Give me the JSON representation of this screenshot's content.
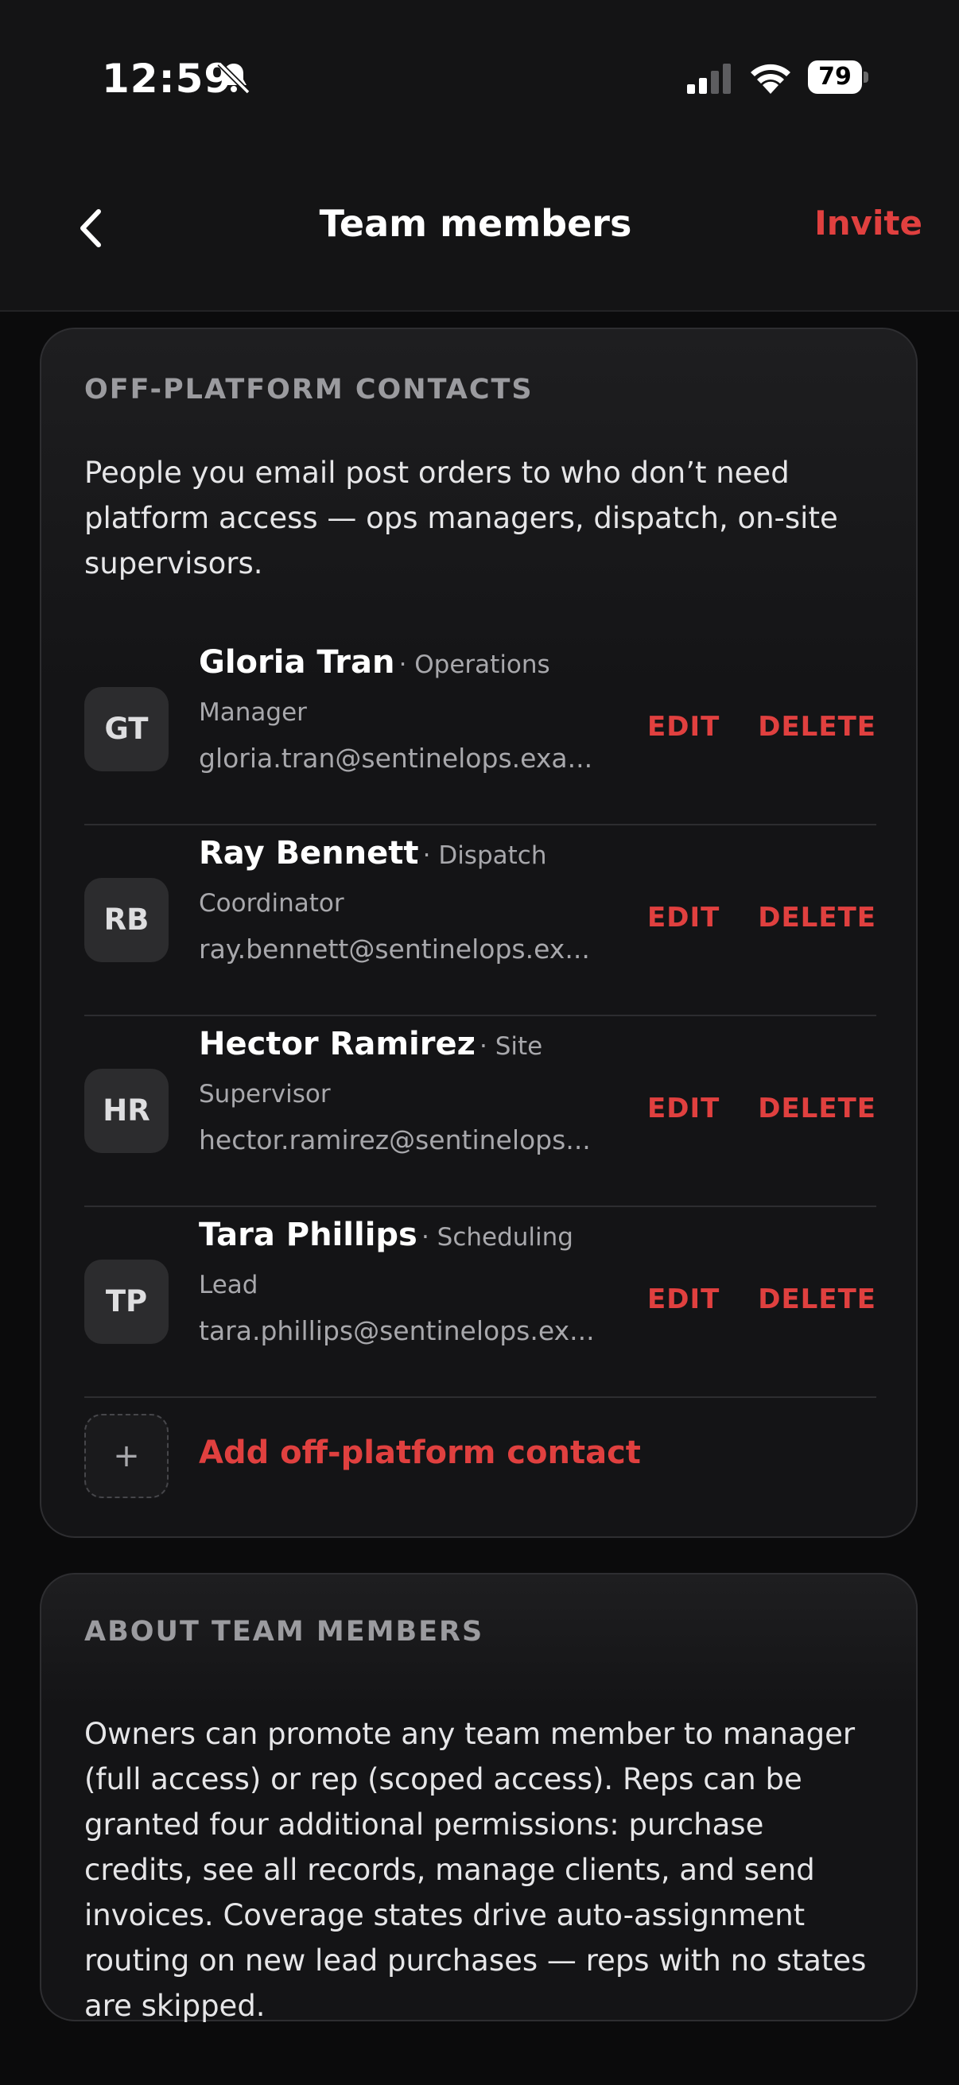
{
  "status_bar": {
    "time": "12:59",
    "battery": "79"
  },
  "nav": {
    "title": "Team members",
    "invite_label": "Invite"
  },
  "off_platform": {
    "section_title": "OFF-PLATFORM CONTACTS",
    "description": "People you email post orders to who don’t need platform access — ops managers, dispatch, on-site supervisors.",
    "edit_label": "EDIT",
    "delete_label": "DELETE",
    "contacts": [
      {
        "initials": "GT",
        "name": "Gloria Tran",
        "role_part1": "· Operations",
        "role_part2": "Manager",
        "email": "gloria.tran@sentinelops.exa..."
      },
      {
        "initials": "RB",
        "name": "Ray Bennett",
        "role_part1": "· Dispatch",
        "role_part2": "Coordinator",
        "email": "ray.bennett@sentinelops.ex..."
      },
      {
        "initials": "HR",
        "name": "Hector Ramirez",
        "role_part1": "· Site",
        "role_part2": "Supervisor",
        "email": "hector.ramirez@sentinelops..."
      },
      {
        "initials": "TP",
        "name": "Tara Phillips",
        "role_part1": "· Scheduling",
        "role_part2": "Lead",
        "email": "tara.phillips@sentinelops.ex..."
      }
    ],
    "add_icon": "+",
    "add_label": "Add off-platform contact"
  },
  "about": {
    "section_title": "ABOUT TEAM MEMBERS",
    "text": "Owners can promote any team member to manager (full access) or rep (scoped access). Reps can be granted four additional permissions: purchase credits, see all records, manage clients, and send invoices. Coverage states drive auto-assignment routing on new lead purchases — reps with no states are skipped."
  },
  "colors": {
    "accent": "#e0403f",
    "background": "#0b0b0c",
    "card": "#1c1c1e"
  },
  "icons": [
    "back-chevron-icon",
    "bell-muted-icon",
    "cellular-signal-icon",
    "wifi-icon",
    "battery-icon",
    "plus-icon"
  ]
}
